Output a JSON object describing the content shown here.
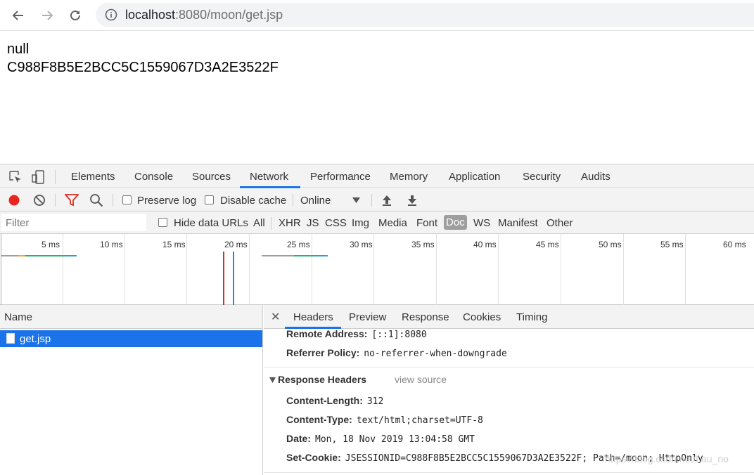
{
  "browser": {
    "url_host": "localhost",
    "url_rest": ":8080/moon/get.jsp"
  },
  "page": {
    "line1": "null",
    "line2": "C988F8B5E2BCC5C1559067D3A2E3522F"
  },
  "devtools": {
    "tabs": [
      "Elements",
      "Console",
      "Sources",
      "Network",
      "Performance",
      "Memory",
      "Application",
      "Security",
      "Audits"
    ],
    "active_tab": "Network",
    "toolbar": {
      "preserve_log": "Preserve log",
      "disable_cache": "Disable cache",
      "throttle": "Online"
    },
    "filter": {
      "placeholder": "Filter",
      "hide_data_urls": "Hide data URLs",
      "types": [
        "All",
        "XHR",
        "JS",
        "CSS",
        "Img",
        "Media",
        "Font",
        "Doc",
        "WS",
        "Manifest",
        "Other"
      ],
      "selected_type": "Doc"
    },
    "timeline_ticks": [
      "5 ms",
      "10 ms",
      "15 ms",
      "20 ms",
      "25 ms",
      "30 ms",
      "35 ms",
      "40 ms",
      "45 ms",
      "50 ms",
      "55 ms",
      "60 ms"
    ],
    "name_header": "Name",
    "requests": [
      {
        "name": "get.jsp"
      }
    ],
    "detail_tabs": [
      "Headers",
      "Preview",
      "Response",
      "Cookies",
      "Timing"
    ],
    "active_detail_tab": "Headers",
    "general": [
      {
        "key": "Remote Address:",
        "value": "[::1]:8080"
      },
      {
        "key": "Referrer Policy:",
        "value": "no-referrer-when-downgrade"
      }
    ],
    "response_headers_title": "Response Headers",
    "view_source": "view source",
    "response_headers": [
      {
        "key": "Content-Length:",
        "value": "312"
      },
      {
        "key": "Content-Type:",
        "value": "text/html;charset=UTF-8"
      },
      {
        "key": "Date:",
        "value": "Mon, 18 Nov 2019 13:04:58 GMT"
      },
      {
        "key": "Set-Cookie:",
        "value": "JSESSIONID=C988F8B5E2BCC5C1559067D3A2E3522F; Path=/moon; HttpOnly"
      }
    ]
  },
  "watermark": "https://blog.csdn.net/Lau_no",
  "colors": {
    "accent": "#1a73e8",
    "record": "#e8261f",
    "filter_icon": "#d93025"
  }
}
